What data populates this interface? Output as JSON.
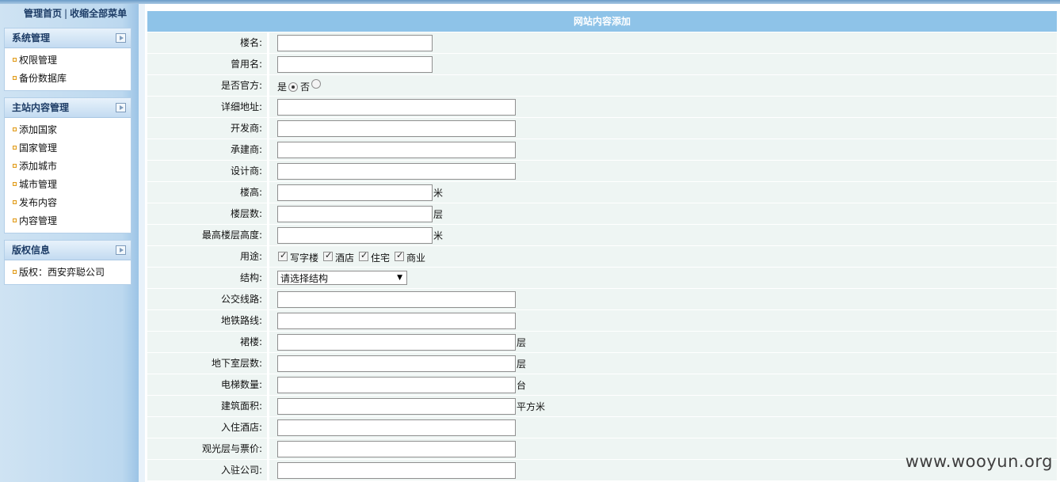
{
  "sidebar": {
    "top_links": [
      "管理首页",
      "收缩全部菜单"
    ],
    "top_separator": "|",
    "panels": [
      {
        "title": "系统管理",
        "items": [
          "权限管理",
          "备份数据库"
        ]
      },
      {
        "title": "主站内容管理",
        "items": [
          "添加国家",
          "国家管理",
          "添加城市",
          "城市管理",
          "发布内容",
          "内容管理"
        ]
      },
      {
        "title": "版权信息",
        "items": [
          "版权：西安弈聪公司"
        ]
      }
    ]
  },
  "form": {
    "title": "网站内容添加",
    "fields": {
      "name": {
        "label": "楼名:",
        "value": ""
      },
      "former_name": {
        "label": "曾用名:",
        "value": ""
      },
      "official": {
        "label": "是否官方:",
        "options": [
          "是",
          "否"
        ],
        "selected": "是"
      },
      "address": {
        "label": "详细地址:",
        "value": ""
      },
      "developer": {
        "label": "开发商:",
        "value": ""
      },
      "contractor": {
        "label": "承建商:",
        "value": ""
      },
      "designer": {
        "label": "设计商:",
        "value": ""
      },
      "height": {
        "label": "楼高:",
        "value": "",
        "unit": "米"
      },
      "floors": {
        "label": "楼层数:",
        "value": "",
        "unit": "层"
      },
      "top_floor_height": {
        "label": "最高楼层高度:",
        "value": "",
        "unit": "米"
      },
      "usage": {
        "label": "用途:",
        "options": [
          "写字楼",
          "酒店",
          "住宅",
          "商业"
        ],
        "checked": [
          true,
          true,
          true,
          true
        ]
      },
      "structure": {
        "label": "结构:",
        "selected": "请选择结构"
      },
      "bus": {
        "label": "公交线路:",
        "value": ""
      },
      "metro": {
        "label": "地铁路线:",
        "value": ""
      },
      "podium": {
        "label": "裙楼:",
        "value": "",
        "unit": "层"
      },
      "basement": {
        "label": "地下室层数:",
        "value": "",
        "unit": "层"
      },
      "elevators": {
        "label": "电梯数量:",
        "value": "",
        "unit": "台"
      },
      "area": {
        "label": "建筑面积:",
        "value": "",
        "unit": "平方米"
      },
      "hotel": {
        "label": "入住酒店:",
        "value": ""
      },
      "observation": {
        "label": "观光层与票价:",
        "value": ""
      },
      "companies": {
        "label": "入驻公司:",
        "value": ""
      }
    }
  },
  "watermark": "www.wooyun.org"
}
